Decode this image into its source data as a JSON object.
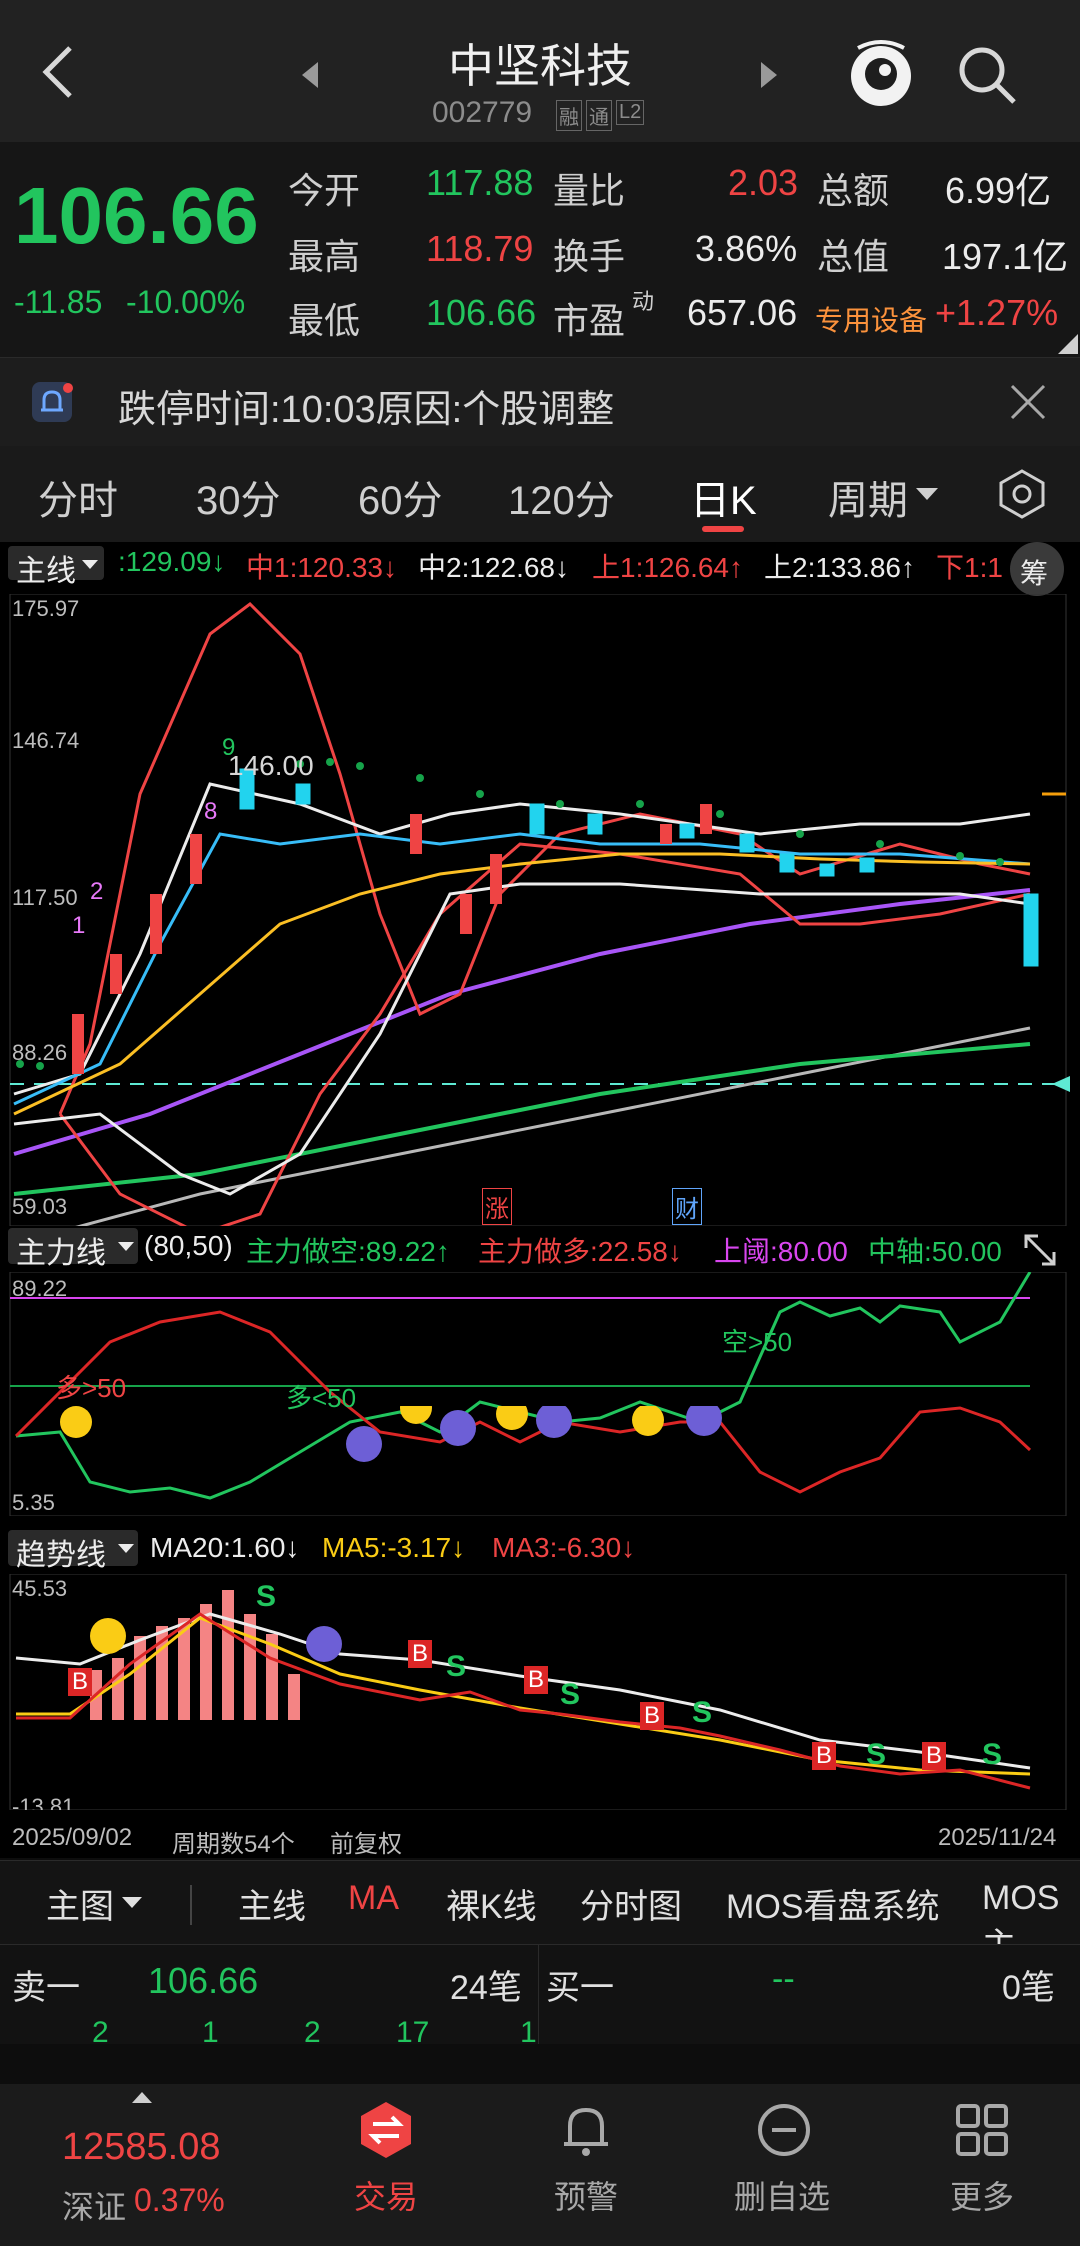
{
  "header": {
    "title": "中坚科技",
    "code": "002779",
    "badges": [
      "融",
      "通",
      "L2"
    ]
  },
  "quote": {
    "price": "106.66",
    "change": "-11.85",
    "change_pct": "-10.00%",
    "fields": [
      {
        "label": "今开",
        "value": "117.88",
        "color": "#22c55e"
      },
      {
        "label": "量比",
        "value": "2.03",
        "color": "#ef4444"
      },
      {
        "label": "总额",
        "value": "6.99亿",
        "color": "#ececec"
      },
      {
        "label": "最高",
        "value": "118.79",
        "color": "#ef4444"
      },
      {
        "label": "换手",
        "value": "3.86%",
        "color": "#ececec"
      },
      {
        "label": "总值",
        "value": "197.1亿",
        "color": "#ececec"
      },
      {
        "label": "最低",
        "value": "106.66",
        "color": "#22c55e"
      },
      {
        "label": "市盈",
        "sup": "动",
        "value": "657.06",
        "color": "#ececec"
      }
    ],
    "sector_name": "专用设备",
    "sector_change": "+1.27%"
  },
  "notice": {
    "text": "跌停时间:10:03原因:个股调整"
  },
  "period_tabs": [
    "分时",
    "30分",
    "60分",
    "120分",
    "日K",
    "周期"
  ],
  "active_period": "日K",
  "main_chart": {
    "selector": "主线",
    "legend": [
      {
        "text": ":129.09↓",
        "color": "#22c55e"
      },
      {
        "text": "中1:120.33↓",
        "color": "#ef4444"
      },
      {
        "text": "中2:122.68↓",
        "color": "#ececec"
      },
      {
        "text": "上1:126.64↑",
        "color": "#ef4444"
      },
      {
        "text": "上2:133.86↑",
        "color": "#ececec"
      },
      {
        "text": "下1:1",
        "color": "#ef4444"
      }
    ],
    "chip_button": "筹",
    "y_ticks": [
      "175.97",
      "146.74",
      "117.50",
      "88.26",
      "59.03"
    ],
    "markers": {
      "zhang": "涨",
      "cai": "财"
    },
    "peak_label": "146.00",
    "seq_labels": [
      "1",
      "2",
      "8",
      "9"
    ]
  },
  "sub_chart_a": {
    "selector": "主力线",
    "params": "(80,50)",
    "legend": [
      {
        "text": "主力做空:89.22↑",
        "color": "#22c55e"
      },
      {
        "text": "主力做多:22.58↓",
        "color": "#ef4444"
      },
      {
        "text": "上阈:80.00",
        "color": "#d946ef"
      },
      {
        "text": "中轴:50.00",
        "color": "#22c55e"
      }
    ],
    "y_ticks": [
      "89.22",
      "5.35"
    ],
    "annotations": [
      "多>50",
      "多<50",
      "空>50"
    ]
  },
  "sub_chart_b": {
    "selector": "趋势线",
    "legend": [
      {
        "text": "MA20:1.60↓",
        "color": "#ececec"
      },
      {
        "text": "MA5:-3.17↓",
        "color": "#facc15"
      },
      {
        "text": "MA3:-6.30↓",
        "color": "#ef4444"
      }
    ],
    "y_ticks": [
      "45.53",
      "-13.81"
    ],
    "buy_label": "B",
    "sell_label": "S"
  },
  "date_bar": {
    "start": "2025/09/02",
    "periods": "周期数54个",
    "adjust": "前复权",
    "end": "2025/11/24"
  },
  "menu": {
    "items": [
      "主图",
      "主线",
      "MA",
      "裸K线",
      "分时图",
      "MOS看盘系统",
      "MOS主"
    ],
    "active": "MA"
  },
  "order_book": {
    "sell_label": "卖一",
    "sell_price": "106.66",
    "sell_count": "24笔",
    "buy_label": "买一",
    "buy_price": "--",
    "buy_count": "0笔",
    "queue": [
      "2",
      "1",
      "2",
      "17",
      "1"
    ]
  },
  "bottom_nav": {
    "index_value": "12585.08",
    "index_name": "深证",
    "index_change": "0.37%",
    "items": [
      "交易",
      "预警",
      "删自选",
      "更多"
    ]
  },
  "colors": {
    "up": "#ef4444",
    "down": "#22c55e",
    "accent_cyan": "#5eead4",
    "purple": "#d946ef"
  }
}
